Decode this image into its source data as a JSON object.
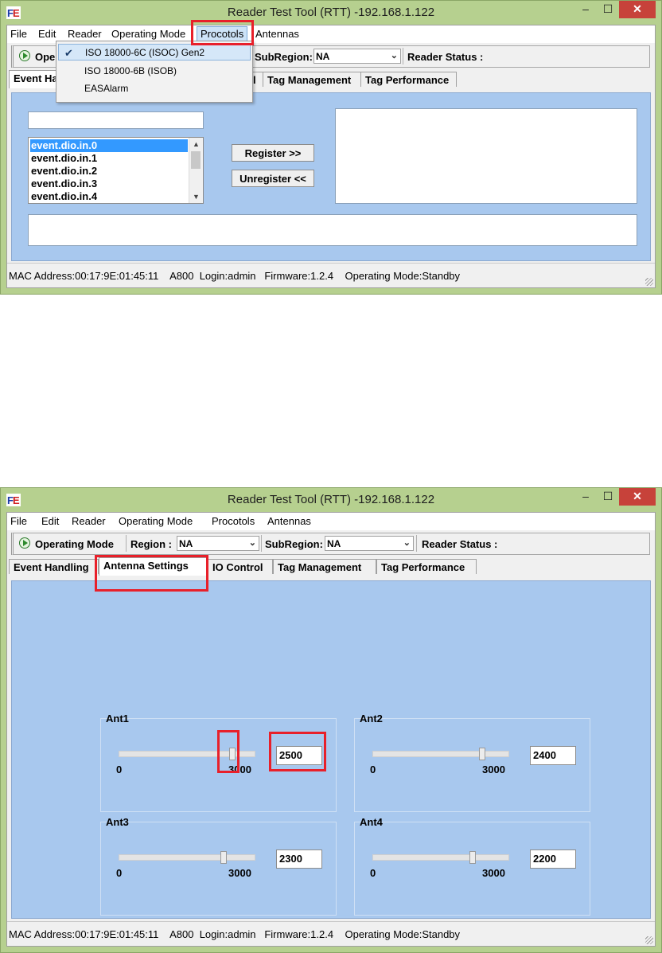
{
  "window_title": "Reader Test Tool (RTT) -192.168.1.122",
  "window_controls": {
    "minimize": "–",
    "maximize": "☐",
    "close": "✕"
  },
  "menu": [
    "File",
    "Edit",
    "Reader",
    "Operating Mode",
    "Procotols",
    "Antennas"
  ],
  "toolbar": {
    "operating_mode_short": "Ope",
    "operating_mode": "Operating Mode",
    "region_label": "Region :",
    "region_value": "NA",
    "subregion_label": "SubRegion:",
    "subregion_value": "NA",
    "reader_status_label": "Reader Status :"
  },
  "tabs_top": [
    "Event Ha",
    "l",
    "Tag Management",
    "Tag Performance"
  ],
  "tabs": [
    "Event Handling",
    "Antenna Settings",
    "IO Control",
    "Tag Management",
    "Tag Performance"
  ],
  "protocols_menu": {
    "items": [
      "ISO 18000-6C (ISOC) Gen2",
      "ISO 18000-6B (ISOB)",
      "EASAlarm"
    ],
    "checked": "✔"
  },
  "event_handling": {
    "events": [
      "event.dio.in.0",
      "event.dio.in.1",
      "event.dio.in.2",
      "event.dio.in.3",
      "event.dio.in.4"
    ],
    "register_button": "Register >>",
    "unregister_button": "Unregister <<"
  },
  "antenna_settings": {
    "antennas": [
      {
        "name": "Ant1",
        "min": "0",
        "max": "3000",
        "value": "2500",
        "level": 2500
      },
      {
        "name": "Ant2",
        "min": "0",
        "max": "3000",
        "value": "2400",
        "level": 2400
      },
      {
        "name": "Ant3",
        "min": "0",
        "max": "3000",
        "value": "2300",
        "level": 2300
      },
      {
        "name": "Ant4",
        "min": "0",
        "max": "3000",
        "value": "2200",
        "level": 2200
      }
    ]
  },
  "status_bar": "MAC Address:00:17:9E:01:45:11    A800  Login:admin   Firmware:1.2.4    Operating Mode:Standby",
  "colors": {
    "title_bar": "#b6d08f",
    "panel": "#a8c8ee",
    "highlight": "#e8202a",
    "close_button": "#c7423a"
  }
}
